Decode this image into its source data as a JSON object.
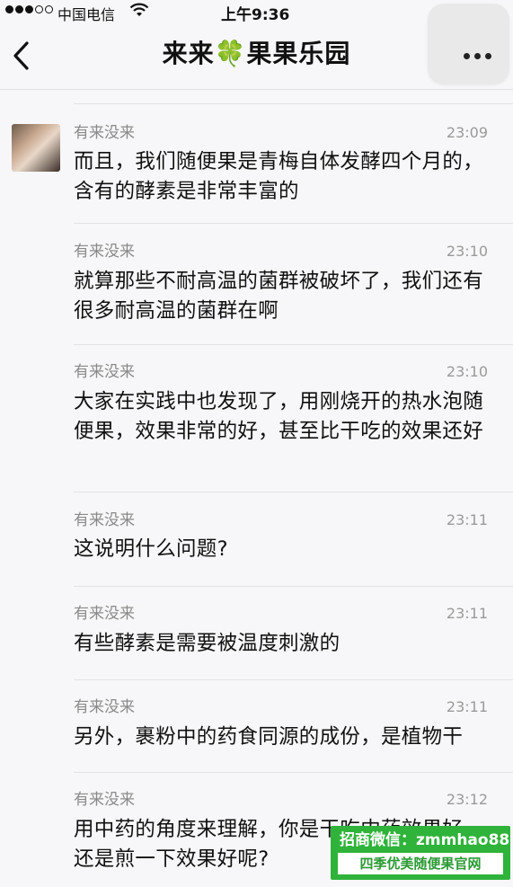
{
  "status_bar": {
    "carrier": "中国电信",
    "time": "上午9:36"
  },
  "nav": {
    "title": "来来🍀果果乐园"
  },
  "messages": [
    {
      "sender": "有来没来",
      "time": "23:09",
      "text": "而且，我们随便果是青梅自体发酵四个月的，含有的酵素是非常丰富的"
    },
    {
      "sender": "有来没来",
      "time": "23:10",
      "text": "就算那些不耐高温的菌群被破坏了，我们还有很多耐高温的菌群在啊"
    },
    {
      "sender": "有来没来",
      "time": "23:10",
      "text": "大家在实践中也发现了，用刚烧开的热水泡随便果，效果非常的好，甚至比干吃的效果还好"
    },
    {
      "sender": "有来没来",
      "time": "23:11",
      "text": "这说明什么问题?"
    },
    {
      "sender": "有来没来",
      "time": "23:11",
      "text": "有些酵素是需要被温度刺激的"
    },
    {
      "sender": "有来没来",
      "time": "23:11",
      "text": "另外，裹粉中的药食同源的成份，是植物干"
    },
    {
      "sender": "有来没来",
      "time": "23:12",
      "text": "用中药的角度来理解，你是干吃中药效果好，还是煎一下效果好呢?"
    }
  ],
  "watermark": {
    "line1": "招商微信：zmmhao88",
    "line2": "四季优美随便果官网"
  },
  "colors": {
    "background": "#f7f6f8",
    "watermark_green": "#2fb33a"
  }
}
